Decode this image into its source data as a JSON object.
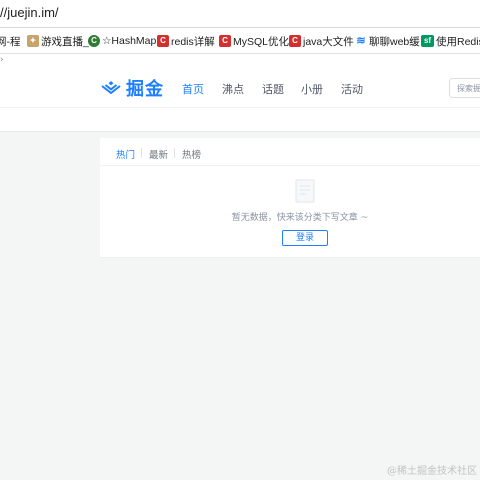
{
  "browser": {
    "address": "//juejin.im/",
    "bookmarks": [
      {
        "label": "网-程",
        "icon": "",
        "color": ""
      },
      {
        "label": "游戏直播_",
        "icon": "bookmark-favicon-icon",
        "color": "#8a6d3b"
      },
      {
        "label": "☆HashMap",
        "icon": "c-icon",
        "color": "#2e7d32"
      },
      {
        "label": "redis详解",
        "icon": "c-icon",
        "color": "#d32f2f"
      },
      {
        "label": "MySQL优化",
        "icon": "c-icon",
        "color": "#d32f2f"
      },
      {
        "label": "java大文件",
        "icon": "c-icon",
        "color": "#d32f2f"
      },
      {
        "label": "聊聊web缓",
        "icon": "juejin-icon",
        "color": "#1e80ff"
      },
      {
        "label": "使用Redis",
        "icon": "sf-icon",
        "color": "#009a61"
      }
    ]
  },
  "header": {
    "logo_text": "掘金",
    "nav": [
      "首页",
      "沸点",
      "话题",
      "小册",
      "活动"
    ],
    "active_nav": "首页",
    "search_placeholder": "探索掘金"
  },
  "feed": {
    "tabs": [
      "热门",
      "最新",
      "热榜"
    ],
    "active_tab": "热门",
    "empty_text": "暂无数据，快来该分类下写文章 ~",
    "login_label": "登录"
  },
  "watermark": "@稀土掘金技术社区",
  "colors": {
    "brand": "#1e80ff",
    "text": "#515767",
    "muted": "#8a919f"
  }
}
